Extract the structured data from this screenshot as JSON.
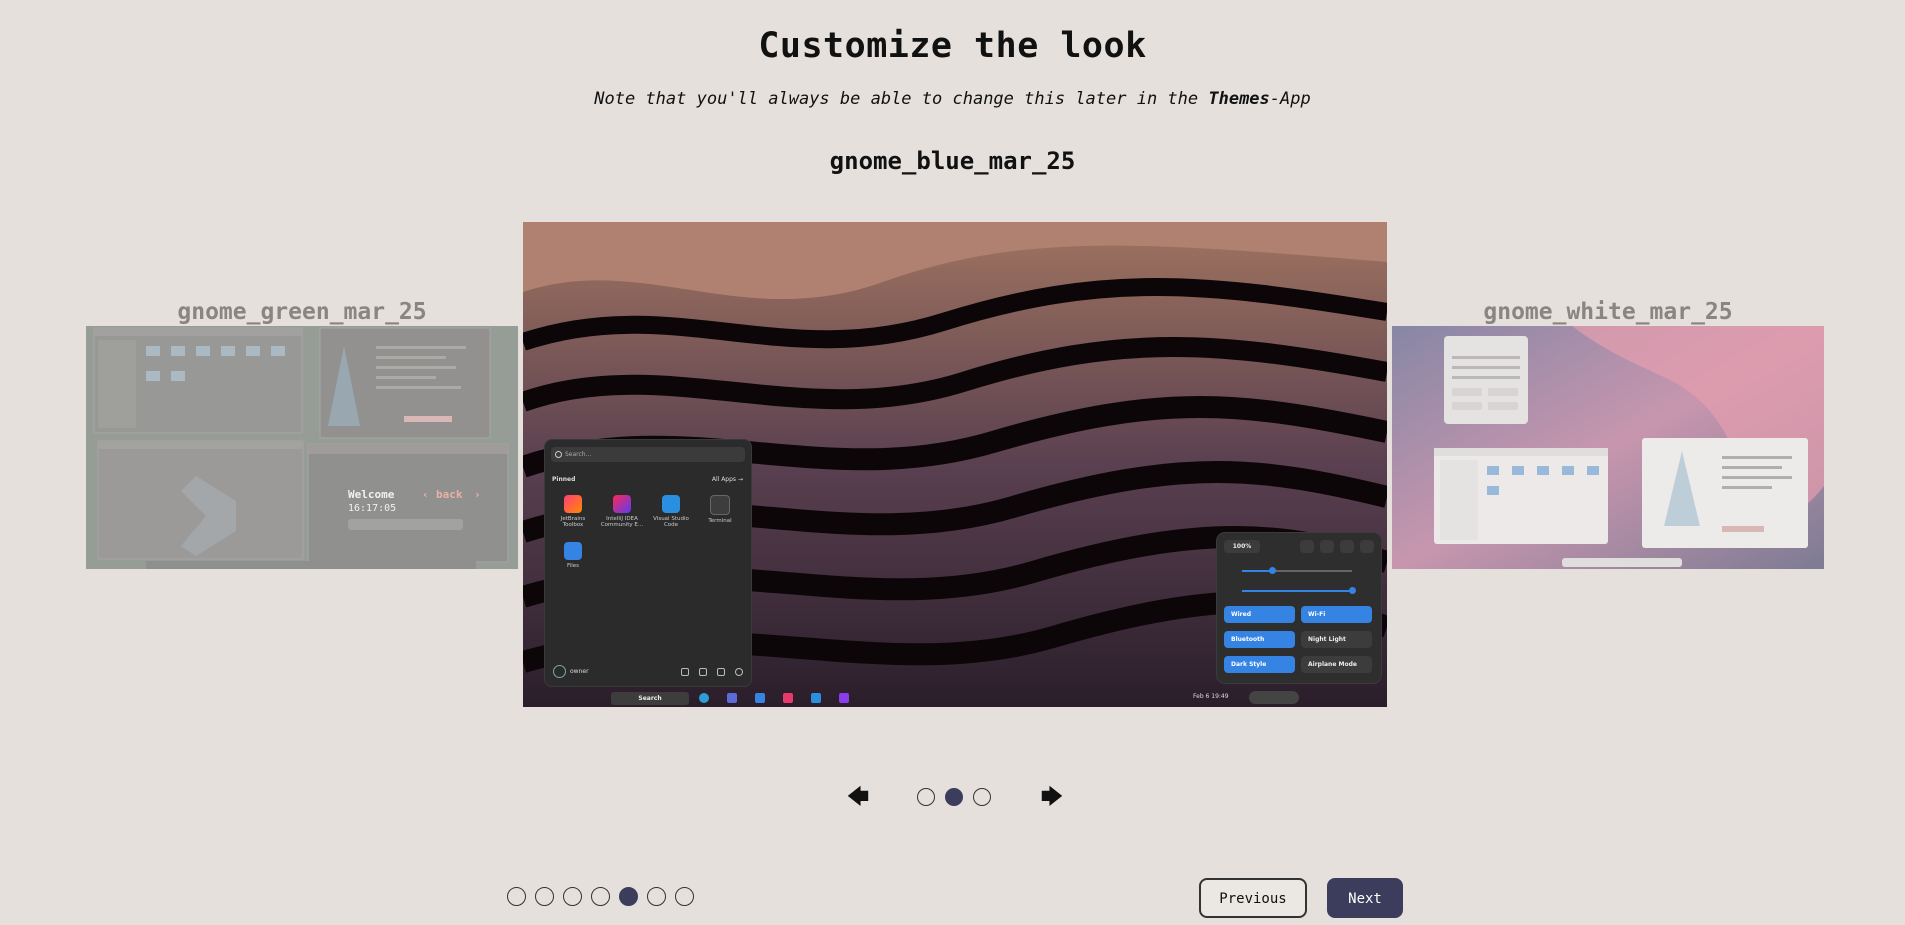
{
  "header": {
    "title": "Customize the look",
    "subtitle_pre": "Note that you'll always be able to change this later in the ",
    "subtitle_bold": "Themes",
    "subtitle_post": "-App"
  },
  "carousel": {
    "current_theme": "gnome_blue_mar_25",
    "prev_theme": "gnome_green_mar_25",
    "next_theme": "gnome_white_mar_25",
    "prev_arrow_icon": "arrow-left-icon",
    "next_arrow_icon": "arrow-right-icon",
    "page_count": 3,
    "active_page": 2
  },
  "preview_blue": {
    "start_menu": {
      "search_placeholder": "Search...",
      "pinned_label": "Pinned",
      "all_apps_label": "All Apps",
      "apps": [
        "JetBrains Toolbox",
        "IntelliJ IDEA Community E...",
        "Visual Studio Code",
        "Terminal",
        "Files"
      ],
      "user": "owner"
    },
    "taskbar": {
      "search_label": "Search",
      "clock": "Feb 6 19:49"
    },
    "quick_settings": {
      "battery": "100%",
      "tiles": [
        "Wired",
        "Wi-Fi",
        "Bluetooth",
        "Night Light",
        "Dark Style",
        "Airplane Mode"
      ]
    }
  },
  "preview_green": {
    "welcome": "Welcome",
    "back": "back",
    "time": "16:17:05"
  },
  "steps": {
    "count": 7,
    "active": 5
  },
  "footer": {
    "previous_label": "Previous",
    "next_label": "Next"
  },
  "colors": {
    "background": "#e5e0dc",
    "accent": "#3c3c5c",
    "gnome_blue": "#3584e4"
  }
}
